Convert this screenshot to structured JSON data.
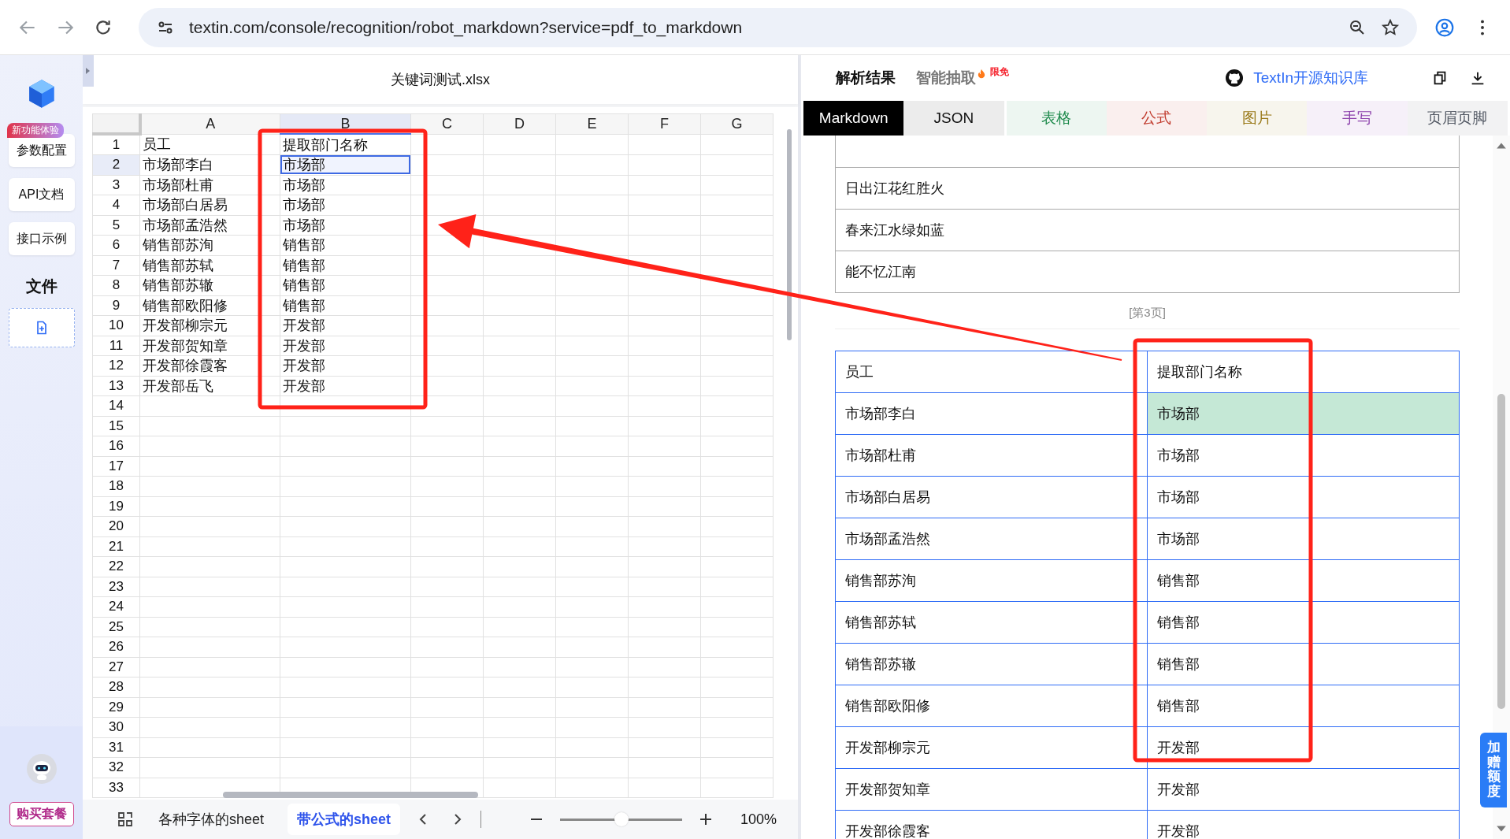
{
  "browser": {
    "url": "textin.com/console/recognition/robot_markdown?service=pdf_to_markdown"
  },
  "sidebar": {
    "items": [
      {
        "label": "参数配置",
        "badge": "新功能体验"
      },
      {
        "label": "API文档"
      },
      {
        "label": "接口示例"
      }
    ],
    "section_title": "文件",
    "buy_button": "购买套餐"
  },
  "spreadsheet": {
    "title": "关键词测试.xlsx",
    "columns": [
      "A",
      "B",
      "C",
      "D",
      "E",
      "F",
      "G"
    ],
    "rows": [
      {
        "number": "1",
        "cells": [
          {
            "text": "员工",
            "selected": false
          },
          {
            "text": "提取部门名称",
            "selected": false
          }
        ]
      },
      {
        "number": "2",
        "cells": [
          {
            "text": "市场部李白",
            "selected": false
          },
          {
            "text": "市场部",
            "selected": true
          }
        ]
      },
      {
        "number": "3",
        "cells": [
          {
            "text": "市场部杜甫",
            "selected": false
          },
          {
            "text": "市场部",
            "selected": false
          }
        ]
      },
      {
        "number": "4",
        "cells": [
          {
            "text": "市场部白居易",
            "selected": false
          },
          {
            "text": "市场部",
            "selected": false
          }
        ]
      },
      {
        "number": "5",
        "cells": [
          {
            "text": "市场部孟浩然",
            "selected": false
          },
          {
            "text": "市场部",
            "selected": false
          }
        ]
      },
      {
        "number": "6",
        "cells": [
          {
            "text": "销售部苏洵",
            "selected": false
          },
          {
            "text": "销售部",
            "selected": false
          }
        ]
      },
      {
        "number": "7",
        "cells": [
          {
            "text": "销售部苏轼",
            "selected": false
          },
          {
            "text": "销售部",
            "selected": false
          }
        ]
      },
      {
        "number": "8",
        "cells": [
          {
            "text": "销售部苏辙",
            "selected": false
          },
          {
            "text": "销售部",
            "selected": false
          }
        ]
      },
      {
        "number": "9",
        "cells": [
          {
            "text": "销售部欧阳修",
            "selected": false
          },
          {
            "text": "销售部",
            "selected": false
          }
        ]
      },
      {
        "number": "10",
        "cells": [
          {
            "text": "开发部柳宗元",
            "selected": false
          },
          {
            "text": "开发部",
            "selected": false
          }
        ]
      },
      {
        "number": "11",
        "cells": [
          {
            "text": "开发部贺知章",
            "selected": false
          },
          {
            "text": "开发部",
            "selected": false
          }
        ]
      },
      {
        "number": "12",
        "cells": [
          {
            "text": "开发部徐霞客",
            "selected": false
          },
          {
            "text": "开发部",
            "selected": false
          }
        ]
      },
      {
        "number": "13",
        "cells": [
          {
            "text": "开发部岳飞",
            "selected": false
          },
          {
            "text": "开发部",
            "selected": false
          }
        ]
      },
      {
        "number": "14"
      },
      {
        "number": "15"
      },
      {
        "number": "16"
      },
      {
        "number": "17"
      },
      {
        "number": "18"
      },
      {
        "number": "19"
      },
      {
        "number": "20"
      },
      {
        "number": "21"
      },
      {
        "number": "22"
      },
      {
        "number": "23"
      },
      {
        "number": "24"
      },
      {
        "number": "25"
      },
      {
        "number": "26"
      },
      {
        "number": "27"
      },
      {
        "number": "28"
      },
      {
        "number": "29"
      },
      {
        "number": "30"
      },
      {
        "number": "31"
      },
      {
        "number": "32"
      },
      {
        "number": "33"
      }
    ],
    "sheet_tabs": [
      {
        "label": "各种字体的sheet",
        "selected": false
      },
      {
        "label": "带公式的sheet",
        "selected": true
      }
    ],
    "zoom": {
      "level": 0.5,
      "reading": "100%"
    }
  },
  "result": {
    "tabs": [
      {
        "label": "解析结果",
        "selected": true
      },
      {
        "label": "智能抽取",
        "selected": false,
        "badge": "限免"
      }
    ],
    "link": "TextIn开源知识库",
    "format_tabs": [
      {
        "label": "Markdown",
        "selected": true,
        "color": "#000000"
      },
      {
        "label": "JSON",
        "selected": false,
        "color": "#111111"
      },
      {
        "label": "表格",
        "selected": false,
        "color": "#1e8a4c"
      },
      {
        "label": "公式",
        "selected": false,
        "color": "#c0392b"
      },
      {
        "label": "图片",
        "selected": false,
        "color": "#9a7a1a"
      },
      {
        "label": "手写",
        "selected": false,
        "color": "#8e44ad"
      },
      {
        "label": "页眉页脚",
        "selected": false,
        "color": "#555b66"
      }
    ],
    "preceding_rows": [
      "日出江花红胜火",
      "春来江水绿如蓝",
      "能不忆江南"
    ],
    "page_marker": "[第3页]",
    "table": {
      "columns": [
        "员工",
        "提取部门名称"
      ],
      "rows": [
        {
          "cells": [
            "市场部李白",
            "市场部"
          ],
          "selected": true
        },
        {
          "cells": [
            "市场部杜甫",
            "市场部"
          ],
          "selected": false
        },
        {
          "cells": [
            "市场部白居易",
            "市场部"
          ],
          "selected": false
        },
        {
          "cells": [
            "市场部孟浩然",
            "市场部"
          ],
          "selected": false
        },
        {
          "cells": [
            "销售部苏洵",
            "销售部"
          ],
          "selected": false
        },
        {
          "cells": [
            "销售部苏轼",
            "销售部"
          ],
          "selected": false
        },
        {
          "cells": [
            "销售部苏辙",
            "销售部"
          ],
          "selected": false
        },
        {
          "cells": [
            "销售部欧阳修",
            "销售部"
          ],
          "selected": false
        },
        {
          "cells": [
            "开发部柳宗元",
            "开发部"
          ],
          "selected": false
        },
        {
          "cells": [
            "开发部贺知章",
            "开发部"
          ],
          "selected": false
        },
        {
          "cells": [
            "开发部徐霞客",
            "开发部"
          ],
          "selected": false
        }
      ]
    }
  },
  "quota_tab": "加赠额度",
  "annotations": [
    {
      "kind": "box"
    },
    {
      "kind": "box"
    },
    {
      "kind": "arrow"
    }
  ]
}
